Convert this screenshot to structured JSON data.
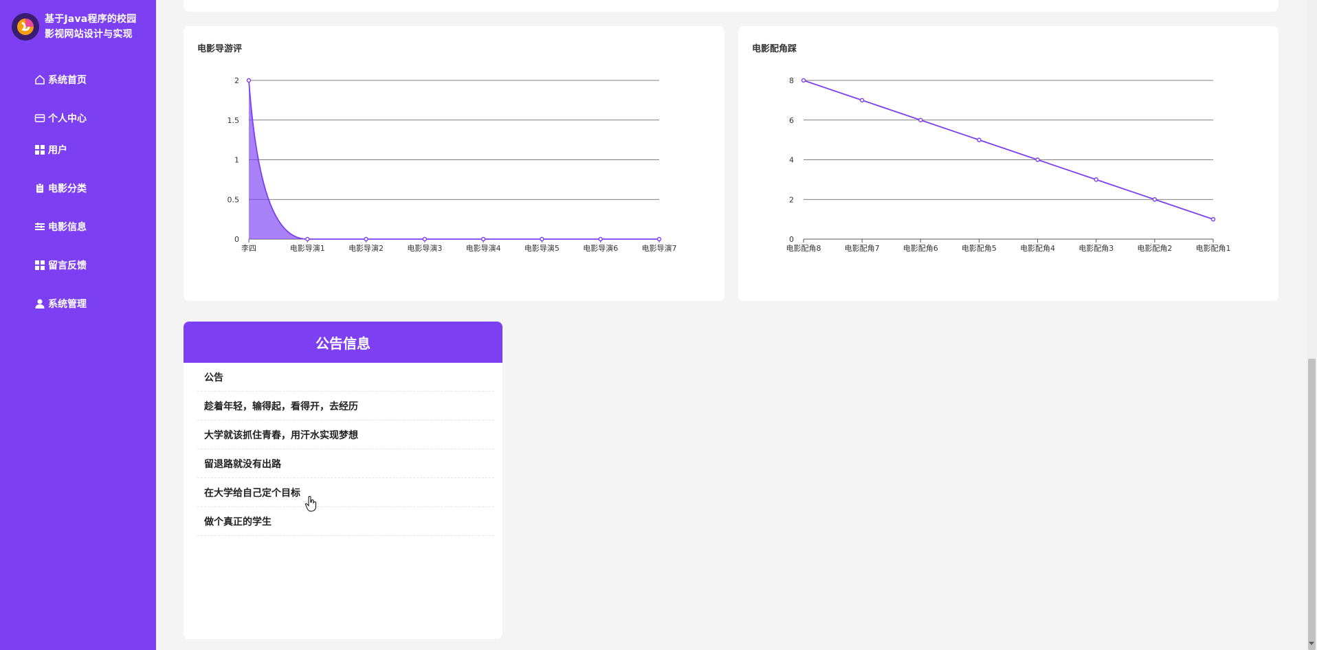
{
  "app": {
    "title": "基于Java程序的校园影视网站设计与实现",
    "title_line1": "基于Java程序的校园",
    "title_line2": "影视网站设计与实现"
  },
  "sidebar": {
    "items": [
      {
        "label": "系统首页",
        "icon": "home-icon"
      },
      {
        "label": "个人中心",
        "icon": "card-icon"
      },
      {
        "label": "用户",
        "icon": "grid-icon"
      },
      {
        "label": "电影分类",
        "icon": "clipboard-icon"
      },
      {
        "label": "电影信息",
        "icon": "list-icon"
      },
      {
        "label": "留言反馈",
        "icon": "grid-icon"
      },
      {
        "label": "系统管理",
        "icon": "user-icon"
      }
    ]
  },
  "charts": {
    "chart1_title": "电影导游评",
    "chart2_title": "电影配角踩"
  },
  "chart_data": [
    {
      "type": "area",
      "title": "电影导游评",
      "categories": [
        "李四",
        "电影导演1",
        "电影导演2",
        "电影导演3",
        "电影导演4",
        "电影导演5",
        "电影导演6",
        "电影导演7"
      ],
      "values": [
        2,
        0,
        0,
        0,
        0,
        0,
        0,
        0
      ],
      "yticks": [
        "0",
        "0.5",
        "1",
        "1.5",
        "2"
      ],
      "ylim": [
        0,
        2
      ],
      "smooth": true,
      "grid": true,
      "color": "#7c3ff2"
    },
    {
      "type": "line",
      "title": "电影配角踩",
      "categories": [
        "电影配角8",
        "电影配角7",
        "电影配角6",
        "电影配角5",
        "电影配角4",
        "电影配角3",
        "电影配角2",
        "电影配角1"
      ],
      "values": [
        8,
        7,
        6,
        5,
        4,
        3,
        2,
        1
      ],
      "yticks": [
        "0",
        "2",
        "4",
        "6",
        "8"
      ],
      "ylim": [
        0,
        8
      ],
      "grid": true,
      "color": "#7c3ff2"
    }
  ],
  "notice": {
    "header": "公告信息",
    "items": [
      "公告",
      "趁着年轻，输得起，看得开，去经历",
      "大学就该抓住青春，用汗水实现梦想",
      "留退路就没有出路",
      "在大学给自己定个目标",
      "做个真正的学生"
    ]
  },
  "colors": {
    "accent": "#7c3ff2",
    "background": "#f4f4f4"
  }
}
